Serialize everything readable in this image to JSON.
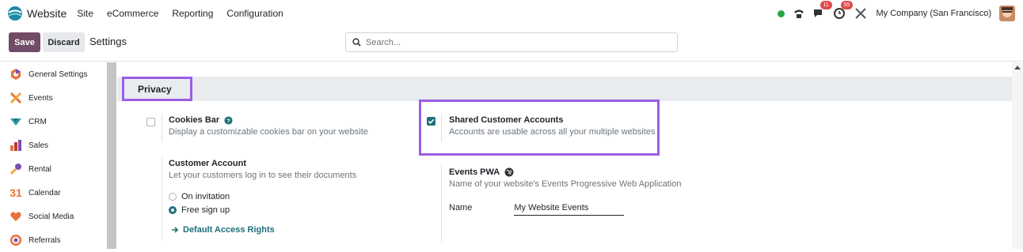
{
  "topbar": {
    "app_name": "Website",
    "menu": [
      "Site",
      "eCommerce",
      "Reporting",
      "Configuration"
    ],
    "status_color": "#28a745",
    "messages_badge": "11",
    "activity_badge": "55",
    "company": "My Company (San Francisco)"
  },
  "control": {
    "save_label": "Save",
    "discard_label": "Discard",
    "title": "Settings",
    "search_placeholder": "Search..."
  },
  "sidebar": {
    "items": [
      {
        "label": "General Settings",
        "icon": "general-settings-icon"
      },
      {
        "label": "Events",
        "icon": "events-icon"
      },
      {
        "label": "CRM",
        "icon": "crm-icon"
      },
      {
        "label": "Sales",
        "icon": "sales-icon"
      },
      {
        "label": "Rental",
        "icon": "rental-icon"
      },
      {
        "label": "Calendar",
        "icon": "calendar-icon",
        "glyph": "31"
      },
      {
        "label": "Social Media",
        "icon": "social-media-icon"
      },
      {
        "label": "Referrals",
        "icon": "referrals-icon"
      }
    ]
  },
  "section": {
    "title": "Privacy"
  },
  "cookies_bar": {
    "title": "Cookies Bar",
    "desc": "Display a customizable cookies bar on your website",
    "checked": false
  },
  "shared_accounts": {
    "title": "Shared Customer Accounts",
    "desc": "Accounts are usable across all your multiple websites",
    "checked": true
  },
  "customer_account": {
    "title": "Customer Account",
    "desc": "Let your customers log in to see their documents",
    "options": [
      "On invitation",
      "Free sign up"
    ],
    "selected": "Free sign up",
    "link": "Default Access Rights"
  },
  "events_pwa": {
    "title": "Events PWA",
    "desc": "Name of your website's Events Progressive Web Application",
    "field_label": "Name",
    "field_value": "My Website Events"
  },
  "colors": {
    "brand": "#714b67",
    "accent": "#1f6f78",
    "highlight": "#9b5de5"
  }
}
